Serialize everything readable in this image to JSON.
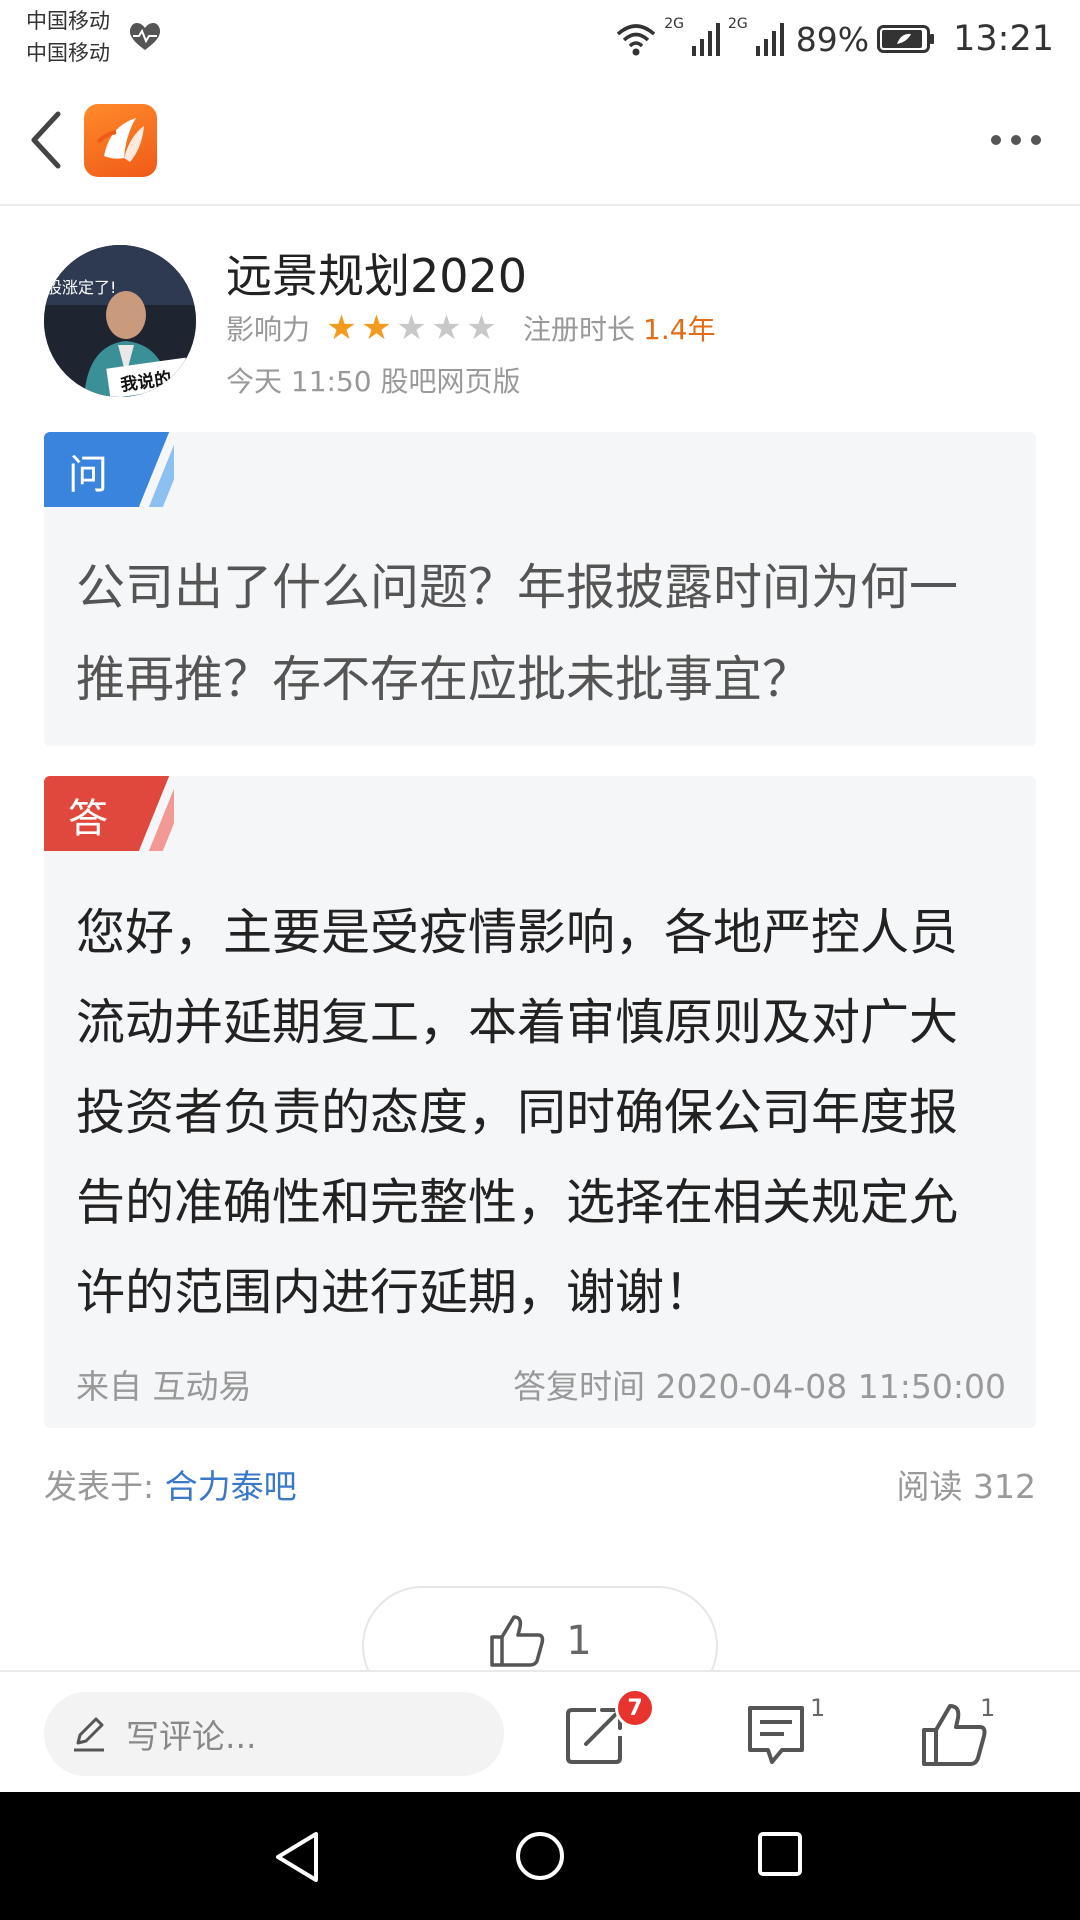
{
  "status_bar": {
    "carrier_1": "中国移动",
    "carrier_2": "中国移动",
    "net_1": "2G",
    "net_2": "2G",
    "battery": "89%",
    "time": "13:21"
  },
  "author": {
    "name": "远景规划2020",
    "influence_label": "影响力",
    "rating": 2,
    "rating_max": 5,
    "reg_label": "注册时长",
    "reg_value": "1.4年",
    "meta": "今天 11:50 股吧网页版",
    "avatar_caption_top": "股涨定了!",
    "avatar_caption_bottom": "我说的"
  },
  "question": {
    "tag": "问",
    "text": "公司出了什么问题？年报披露时间为何一推再推？存不存在应批未批事宜？"
  },
  "answer": {
    "tag": "答",
    "text": "您好，主要是受疫情影响，各地严控人员流动并延期复工，本着审慎原则及对广大投资者负责的态度，同时确保公司年度报告的准确性和完整性，选择在相关规定允许的范围内进行延期，谢谢！",
    "source": "来自 互动易",
    "time": "答复时间 2020-04-08 11:50:00"
  },
  "footer": {
    "posted_label": "发表于: ",
    "bar_name": "合力泰吧",
    "reads": "阅读 312"
  },
  "like_pill": {
    "count": "1"
  },
  "toolbar": {
    "comment_placeholder": "写评论...",
    "share_badge": "7",
    "comment_count": "1",
    "like_count": "1"
  },
  "colors": {
    "brand_orange": "#f26a1f",
    "question_blue": "#3b84dd",
    "answer_red": "#e0473d",
    "link_blue": "#3a78c8",
    "star_active": "#f29b1f"
  }
}
